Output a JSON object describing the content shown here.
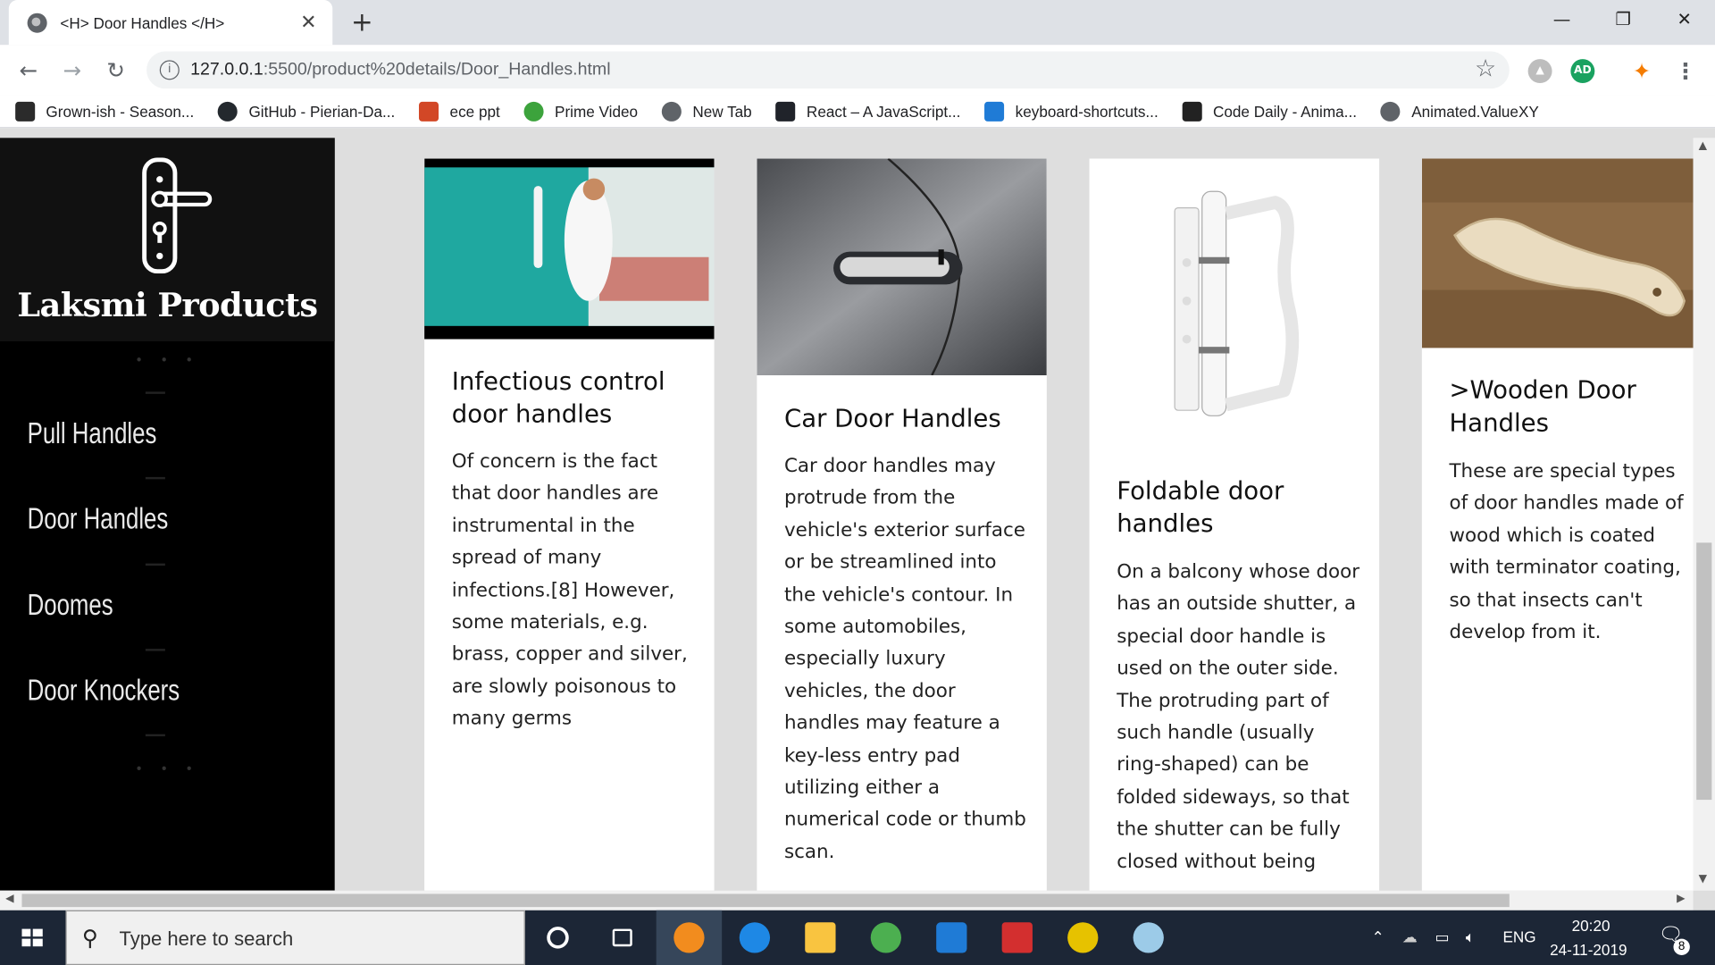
{
  "browser": {
    "tab_title": "<H> Door Handles </H>",
    "url_host": "127.0.0.1",
    "url_path": ":5500/product%20details/Door_Handles.html",
    "bookmarks": [
      {
        "label": "Grown-ish - Season...",
        "icon": "tv-icon",
        "color": "#2b2b2b"
      },
      {
        "label": "GitHub - Pierian-Da...",
        "icon": "github-icon",
        "color": "#24292e"
      },
      {
        "label": "ece ppt",
        "icon": "powerpoint-icon",
        "color": "#d24726"
      },
      {
        "label": "Prime Video",
        "icon": "play-icon",
        "color": "#3ca33c"
      },
      {
        "label": "New Tab",
        "icon": "globe-icon",
        "color": "#5f6368"
      },
      {
        "label": "React – A JavaScript...",
        "icon": "react-icon",
        "color": "#20232a"
      },
      {
        "label": "keyboard-shortcuts...",
        "icon": "vscode-icon",
        "color": "#1f7bd6"
      },
      {
        "label": "Code Daily - Anima...",
        "icon": "car-icon",
        "color": "#222"
      },
      {
        "label": "Animated.ValueXY",
        "icon": "globe-icon",
        "color": "#5f6368"
      }
    ],
    "profile_initials": "AD"
  },
  "sidebar": {
    "brand": "Laksmi Products",
    "dots": "• • •",
    "links": [
      "Pull Handles",
      "Door Handles",
      "Doomes",
      "Door Knockers"
    ]
  },
  "cards": [
    {
      "title": "Infectious control door handles",
      "body": "Of concern is the fact that door handles are instrumental in the spread of many infections.[8] However, some materials, e.g. brass, copper and silver, are slowly poisonous to many germs"
    },
    {
      "title": "Car Door Handles",
      "body": "Car door handles may protrude from the vehicle's exterior surface or be streamlined into the vehicle's contour. In some automobiles, especially luxury vehicles, the door handles may feature a key-less entry pad utilizing either a numerical code or thumb scan."
    },
    {
      "title": "Foldable door handles",
      "body": "On a balcony whose door has an outside shutter, a special door handle is used on the outer side. The protruding part of such handle (usually ring-shaped) can be folded sideways, so that the shutter can be fully closed without being"
    },
    {
      "title": ">Wooden Door Handles",
      "body": "These are special types of door handles made of wood which is coated with terminator coating, so that insects can't develop from it."
    }
  ],
  "taskbar": {
    "search_placeholder": "Type here to search",
    "language": "ENG",
    "time": "20:20",
    "date": "24-11-2019",
    "notification_count": "8"
  }
}
